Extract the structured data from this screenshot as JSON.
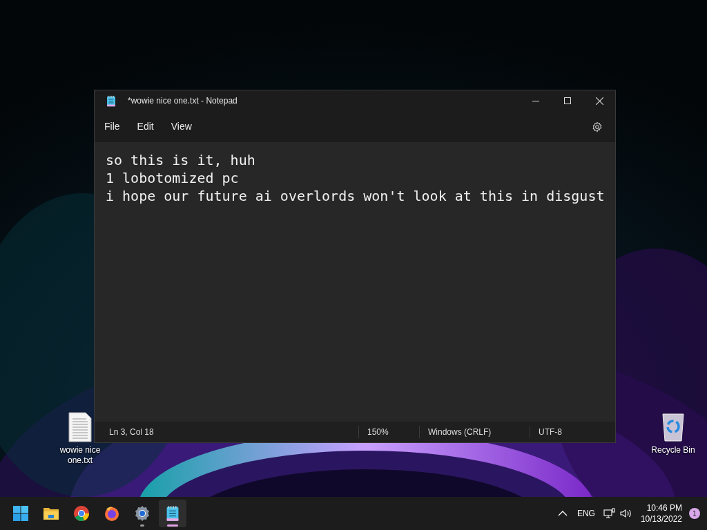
{
  "desktop_icons": [
    {
      "kind": "text-file",
      "label": "wowie nice one.txt"
    },
    {
      "kind": "recycle-bin",
      "label": "Recycle Bin"
    }
  ],
  "window": {
    "title": "*wowie nice one.txt - Notepad",
    "menu": [
      "File",
      "Edit",
      "View"
    ],
    "lines": [
      "so this is it, huh",
      "1 lobotomized pc",
      "i hope our future ai overlords won't look at this in disgust"
    ],
    "status_bar": {
      "position": "Ln 3, Col 18",
      "zoom": "150%",
      "line_ending": "Windows (CRLF)",
      "encoding": "UTF-8"
    }
  },
  "taskbar": {
    "apps": [
      {
        "kind": "start",
        "selected": false,
        "running": false
      },
      {
        "kind": "folder",
        "selected": false,
        "running": false
      },
      {
        "kind": "chrome",
        "selected": false,
        "running": false
      },
      {
        "kind": "firefox",
        "selected": false,
        "running": false
      },
      {
        "kind": "settings",
        "selected": false,
        "running": true
      },
      {
        "kind": "notepad",
        "selected": true,
        "running": true
      }
    ],
    "tray": {
      "language": "ENG",
      "time": "10:46 PM",
      "date": "10/13/2022",
      "notifications": "1"
    }
  }
}
